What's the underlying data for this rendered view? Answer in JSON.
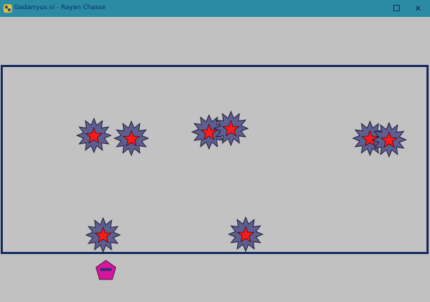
{
  "window": {
    "title": "Gadarryus.vi - Rayan Chasse",
    "icon": "python-icon",
    "maximize_icon": "maximize-icon",
    "close_icon": "close-icon",
    "close_glyph": "✕"
  },
  "game": {
    "enemy_count": 8,
    "enemy_icon": "spiky-star-enemy-icon",
    "player_icon": "pentagon-player-icon",
    "colors": {
      "titlebar": "#2b8ba4",
      "background": "#c0c0c0",
      "border": "#13295d",
      "enemy_body": "#5e5e90",
      "enemy_star": "#ff1a1a",
      "player": "#d4169c"
    }
  }
}
